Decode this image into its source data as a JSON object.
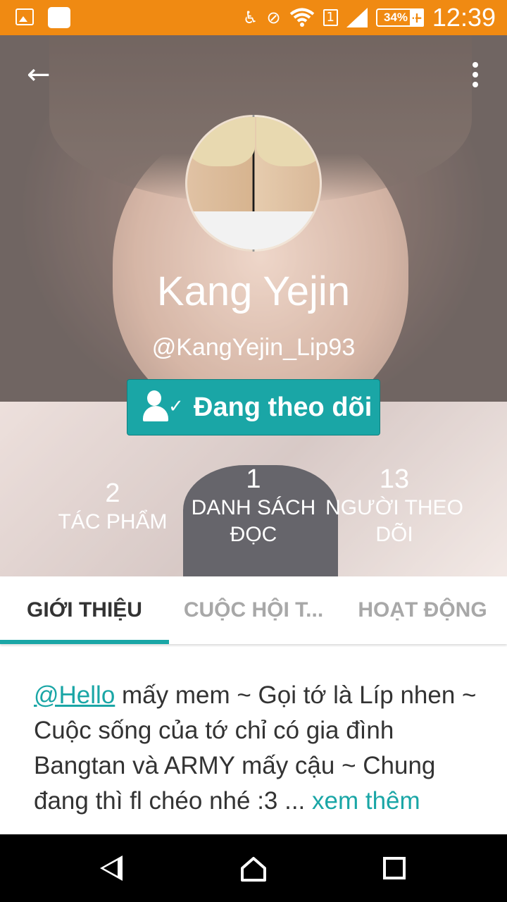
{
  "status_bar": {
    "time": "12:39",
    "battery": "34%",
    "battery_plus": "+",
    "sim": "1"
  },
  "header": {
    "back_icon": "←",
    "name": "Kang Yejin",
    "handle": "@KangYejin_Lip93",
    "follow_label": "Đang theo dõi",
    "stats": [
      {
        "value": "2",
        "label": "TÁC PHẨM"
      },
      {
        "value": "1",
        "label": "DANH SÁCH ĐỌC"
      },
      {
        "value": "13",
        "label": "NGƯỜI THEO DÕI"
      }
    ]
  },
  "tabs": [
    {
      "label": "GIỚI THIỆU"
    },
    {
      "label": "CUỘC HỘI T..."
    },
    {
      "label": "HOẠT ĐỘNG"
    }
  ],
  "about": {
    "mention": "@Hello",
    "line1_rest": " mấy mem ~ Gọi tớ là Líp nhen ~",
    "line2": "Cuộc sống của tớ chỉ có gia đình Bangtan và ARMY mấy cậu ~ Chung",
    "line3": "đang thì fl chéo nhé :3 ...",
    "more_label": "xem thêm"
  },
  "colors": {
    "status_bar": "#f08a12",
    "accent": "#1aa6a6"
  }
}
